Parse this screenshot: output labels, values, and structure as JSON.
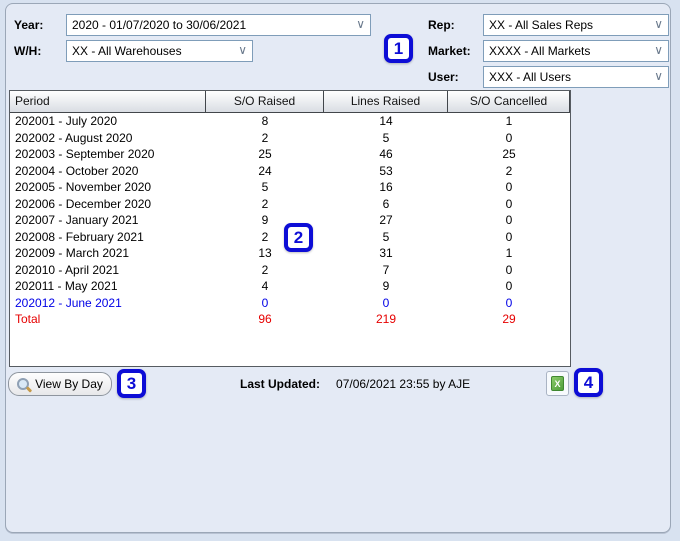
{
  "filters": {
    "year": {
      "label": "Year:",
      "value": "2020 - 01/07/2020 to 30/06/2021"
    },
    "warehouse": {
      "label": "W/H:",
      "value": "XX - All Warehouses"
    },
    "rep": {
      "label": "Rep:",
      "value": "XX - All Sales Reps"
    },
    "market": {
      "label": "Market:",
      "value": "XXXX - All Markets"
    },
    "user": {
      "label": "User:",
      "value": "XXX - All Users"
    }
  },
  "icons": {
    "chevron": "∨",
    "excel_glyph": "X"
  },
  "table": {
    "columns": [
      "Period",
      "S/O Raised",
      "Lines Raised",
      "S/O Cancelled"
    ],
    "rows": [
      {
        "period": "202001 - July 2020",
        "so_raised": "8",
        "lines_raised": "14",
        "so_cancelled": "1",
        "style": "normal"
      },
      {
        "period": "202002 - August 2020",
        "so_raised": "2",
        "lines_raised": "5",
        "so_cancelled": "0",
        "style": "normal"
      },
      {
        "period": "202003 - September 2020",
        "so_raised": "25",
        "lines_raised": "46",
        "so_cancelled": "25",
        "style": "normal"
      },
      {
        "period": "202004 - October 2020",
        "so_raised": "24",
        "lines_raised": "53",
        "so_cancelled": "2",
        "style": "normal"
      },
      {
        "period": "202005 - November 2020",
        "so_raised": "5",
        "lines_raised": "16",
        "so_cancelled": "0",
        "style": "normal"
      },
      {
        "period": "202006 - December 2020",
        "so_raised": "2",
        "lines_raised": "6",
        "so_cancelled": "0",
        "style": "normal"
      },
      {
        "period": "202007 - January 2021",
        "so_raised": "9",
        "lines_raised": "27",
        "so_cancelled": "0",
        "style": "normal"
      },
      {
        "period": "202008 - February 2021",
        "so_raised": "2",
        "lines_raised": "5",
        "so_cancelled": "0",
        "style": "normal"
      },
      {
        "period": "202009 - March 2021",
        "so_raised": "13",
        "lines_raised": "31",
        "so_cancelled": "1",
        "style": "normal"
      },
      {
        "period": "202010 - April 2021",
        "so_raised": "2",
        "lines_raised": "7",
        "so_cancelled": "0",
        "style": "normal"
      },
      {
        "period": "202011 - May 2021",
        "so_raised": "4",
        "lines_raised": "9",
        "so_cancelled": "0",
        "style": "normal"
      },
      {
        "period": "202012 - June 2021",
        "so_raised": "0",
        "lines_raised": "0",
        "so_cancelled": "0",
        "style": "current"
      },
      {
        "period": "Total",
        "so_raised": "96",
        "lines_raised": "219",
        "so_cancelled": "29",
        "style": "total"
      }
    ]
  },
  "footer": {
    "view_by_day_label": "View By Day",
    "last_updated_label": "Last Updated:",
    "last_updated_value": "07/06/2021 23:55 by AJE"
  },
  "annotations": {
    "marks": [
      "1",
      "2",
      "3",
      "4"
    ],
    "color": "#0d0dd6"
  },
  "colors": {
    "page_background": "#d8e2f0",
    "panel_background": "#e4eaf5",
    "dropdown_border": "#7f9db9",
    "current_period_text": "#0000e6",
    "total_text": "#e60000",
    "annotation_blue": "#0d0dd6",
    "excel_green": "#4e9e3a"
  }
}
